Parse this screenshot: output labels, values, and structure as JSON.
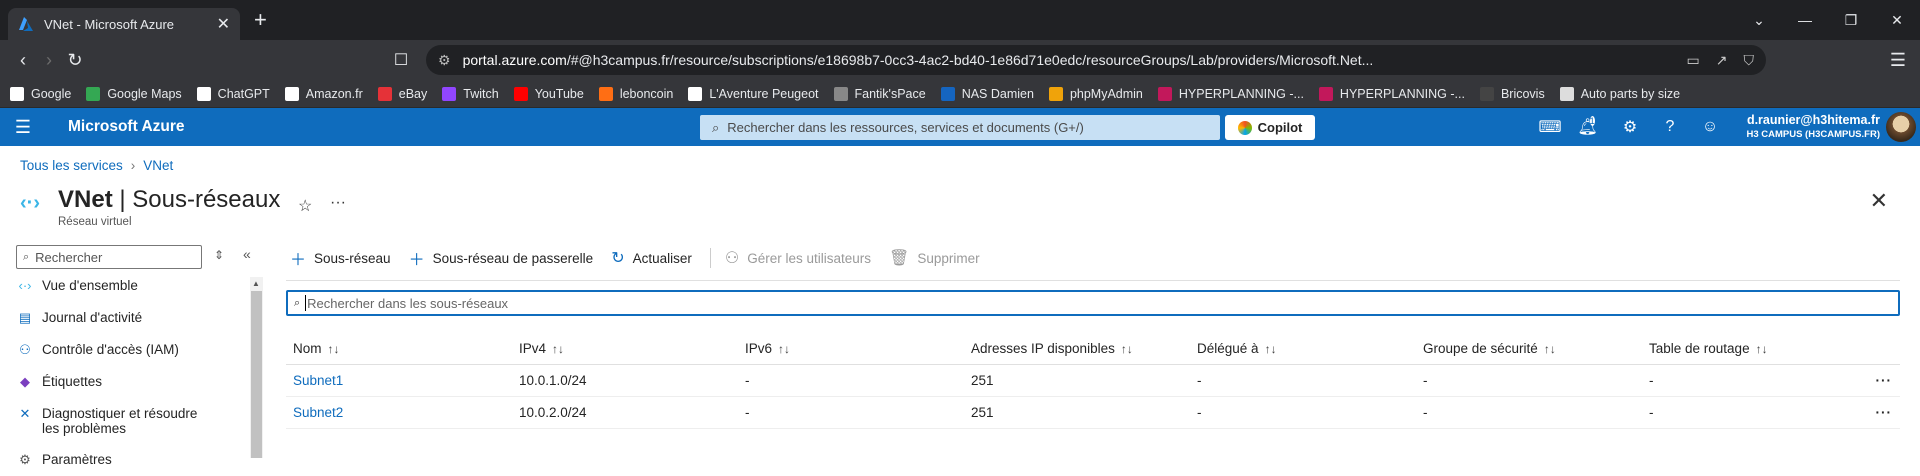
{
  "browser": {
    "tab_title": "VNet - Microsoft Azure",
    "url_host": "portal.azure.com",
    "url_rest": "/#@h3campus.fr/resource/subscriptions/e18698b7-0cc3-4ac2-bd40-1e86d71e0edc/resourceGroups/Lab/providers/Microsoft.Net...",
    "bookmarks": [
      {
        "label": "Google",
        "color": "#ffffff"
      },
      {
        "label": "Google Maps",
        "color": "#34a853"
      },
      {
        "label": "ChatGPT",
        "color": "#ffffff"
      },
      {
        "label": "Amazon.fr",
        "color": "#ffffff"
      },
      {
        "label": "eBay",
        "color": "#e53238"
      },
      {
        "label": "Twitch",
        "color": "#9146ff"
      },
      {
        "label": "YouTube",
        "color": "#ff0000"
      },
      {
        "label": "leboncoin",
        "color": "#ff6e14"
      },
      {
        "label": "L'Aventure Peugeot",
        "color": "#ffffff"
      },
      {
        "label": "Fantik'sPace",
        "color": "#888888"
      },
      {
        "label": "NAS Damien",
        "color": "#1565c0"
      },
      {
        "label": "phpMyAdmin",
        "color": "#f0a30a"
      },
      {
        "label": "HYPERPLANNING -...",
        "color": "#c2185b"
      },
      {
        "label": "HYPERPLANNING -...",
        "color": "#c2185b"
      },
      {
        "label": "Bricovis",
        "color": "#444444"
      },
      {
        "label": "Auto parts by size",
        "color": "#dddddd"
      }
    ]
  },
  "azure": {
    "brand": "Microsoft Azure",
    "search_placeholder": "Rechercher dans les ressources, services et documents (G+/)",
    "copilot": "Copilot",
    "notifications": "1",
    "user_name": "d.raunier@h3hitema.fr",
    "user_org": "H3 CAMPUS (H3CAMPUS.FR)"
  },
  "breadcrumb": {
    "root": "Tous les services",
    "current": "VNet"
  },
  "page": {
    "title_bold": "VNet",
    "title_rest": " | Sous-réseaux",
    "subtitle": "Réseau virtuel"
  },
  "sidebar": {
    "search_placeholder": "Rechercher",
    "items": [
      {
        "label": "Vue d'ensemble",
        "icon": "overview-icon"
      },
      {
        "label": "Journal d'activité",
        "icon": "activity-log-icon"
      },
      {
        "label": "Contrôle d'accès (IAM)",
        "icon": "iam-icon"
      },
      {
        "label": "Étiquettes",
        "icon": "tag-icon"
      },
      {
        "label": "Diagnostiquer et résoudre les problèmes",
        "icon": "wrench-icon"
      },
      {
        "label": "Paramètres",
        "icon": "settings-icon"
      }
    ]
  },
  "toolbar": {
    "add_subnet": "Sous-réseau",
    "add_gateway_subnet": "Sous-réseau de passerelle",
    "refresh": "Actualiser",
    "manage_users": "Gérer les utilisateurs",
    "delete": "Supprimer"
  },
  "filter_placeholder": "Rechercher dans les sous-réseaux",
  "table": {
    "columns": [
      "Nom",
      "IPv4",
      "IPv6",
      "Adresses IP disponibles",
      "Délégué à",
      "Groupe de sécurité",
      "Table de routage"
    ],
    "rows": [
      [
        "Subnet1",
        "10.0.1.0/24",
        "-",
        "251",
        "-",
        "-",
        "-"
      ],
      [
        "Subnet2",
        "10.0.2.0/24",
        "-",
        "251",
        "-",
        "-",
        "-"
      ]
    ]
  }
}
